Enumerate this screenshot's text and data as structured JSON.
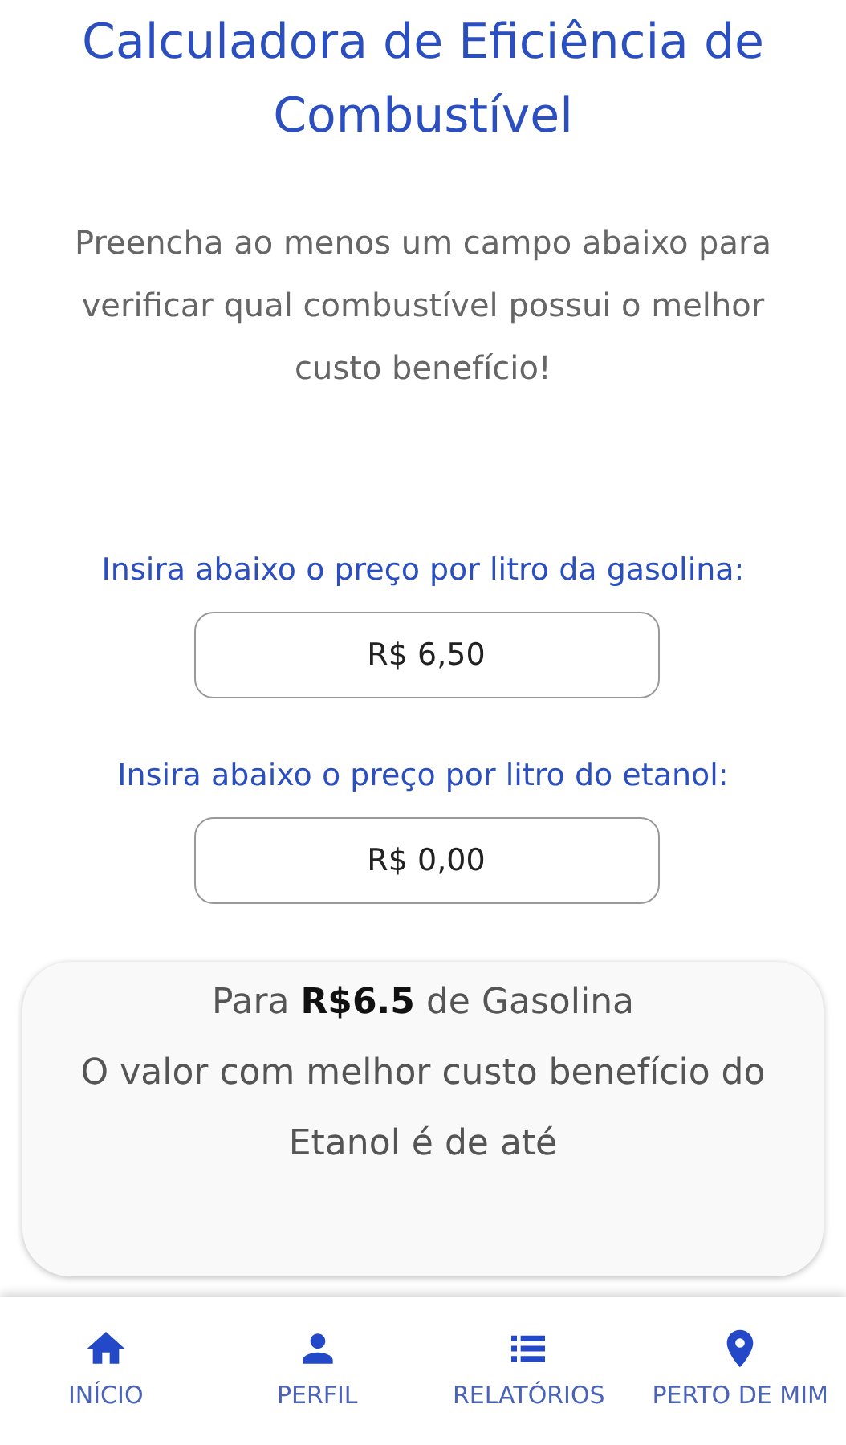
{
  "title": "Calculadora de Eficiência de Combustível",
  "intro": "Preencha ao menos um campo abaixo para verificar qual combustível possui o melhor custo benefício!",
  "fields": [
    {
      "label": "Insira abaixo o preço por litro da gasolina:",
      "value": "R$ 6,50"
    },
    {
      "label": "Insira abaixo o preço por litro do etanol:",
      "value": "R$ 0,00"
    }
  ],
  "result": {
    "lines": [
      "Para **R$6.5** de Gasolina",
      "O valor com melhor custo benefício do Etanol é de até"
    ]
  },
  "nav": [
    {
      "kind": "home",
      "label": "INÍCIO"
    },
    {
      "kind": "person",
      "label": "PERFIL"
    },
    {
      "kind": "list",
      "label": "RELATÓRIOS"
    },
    {
      "kind": "pin",
      "label": "PERTO DE MIM"
    }
  ]
}
